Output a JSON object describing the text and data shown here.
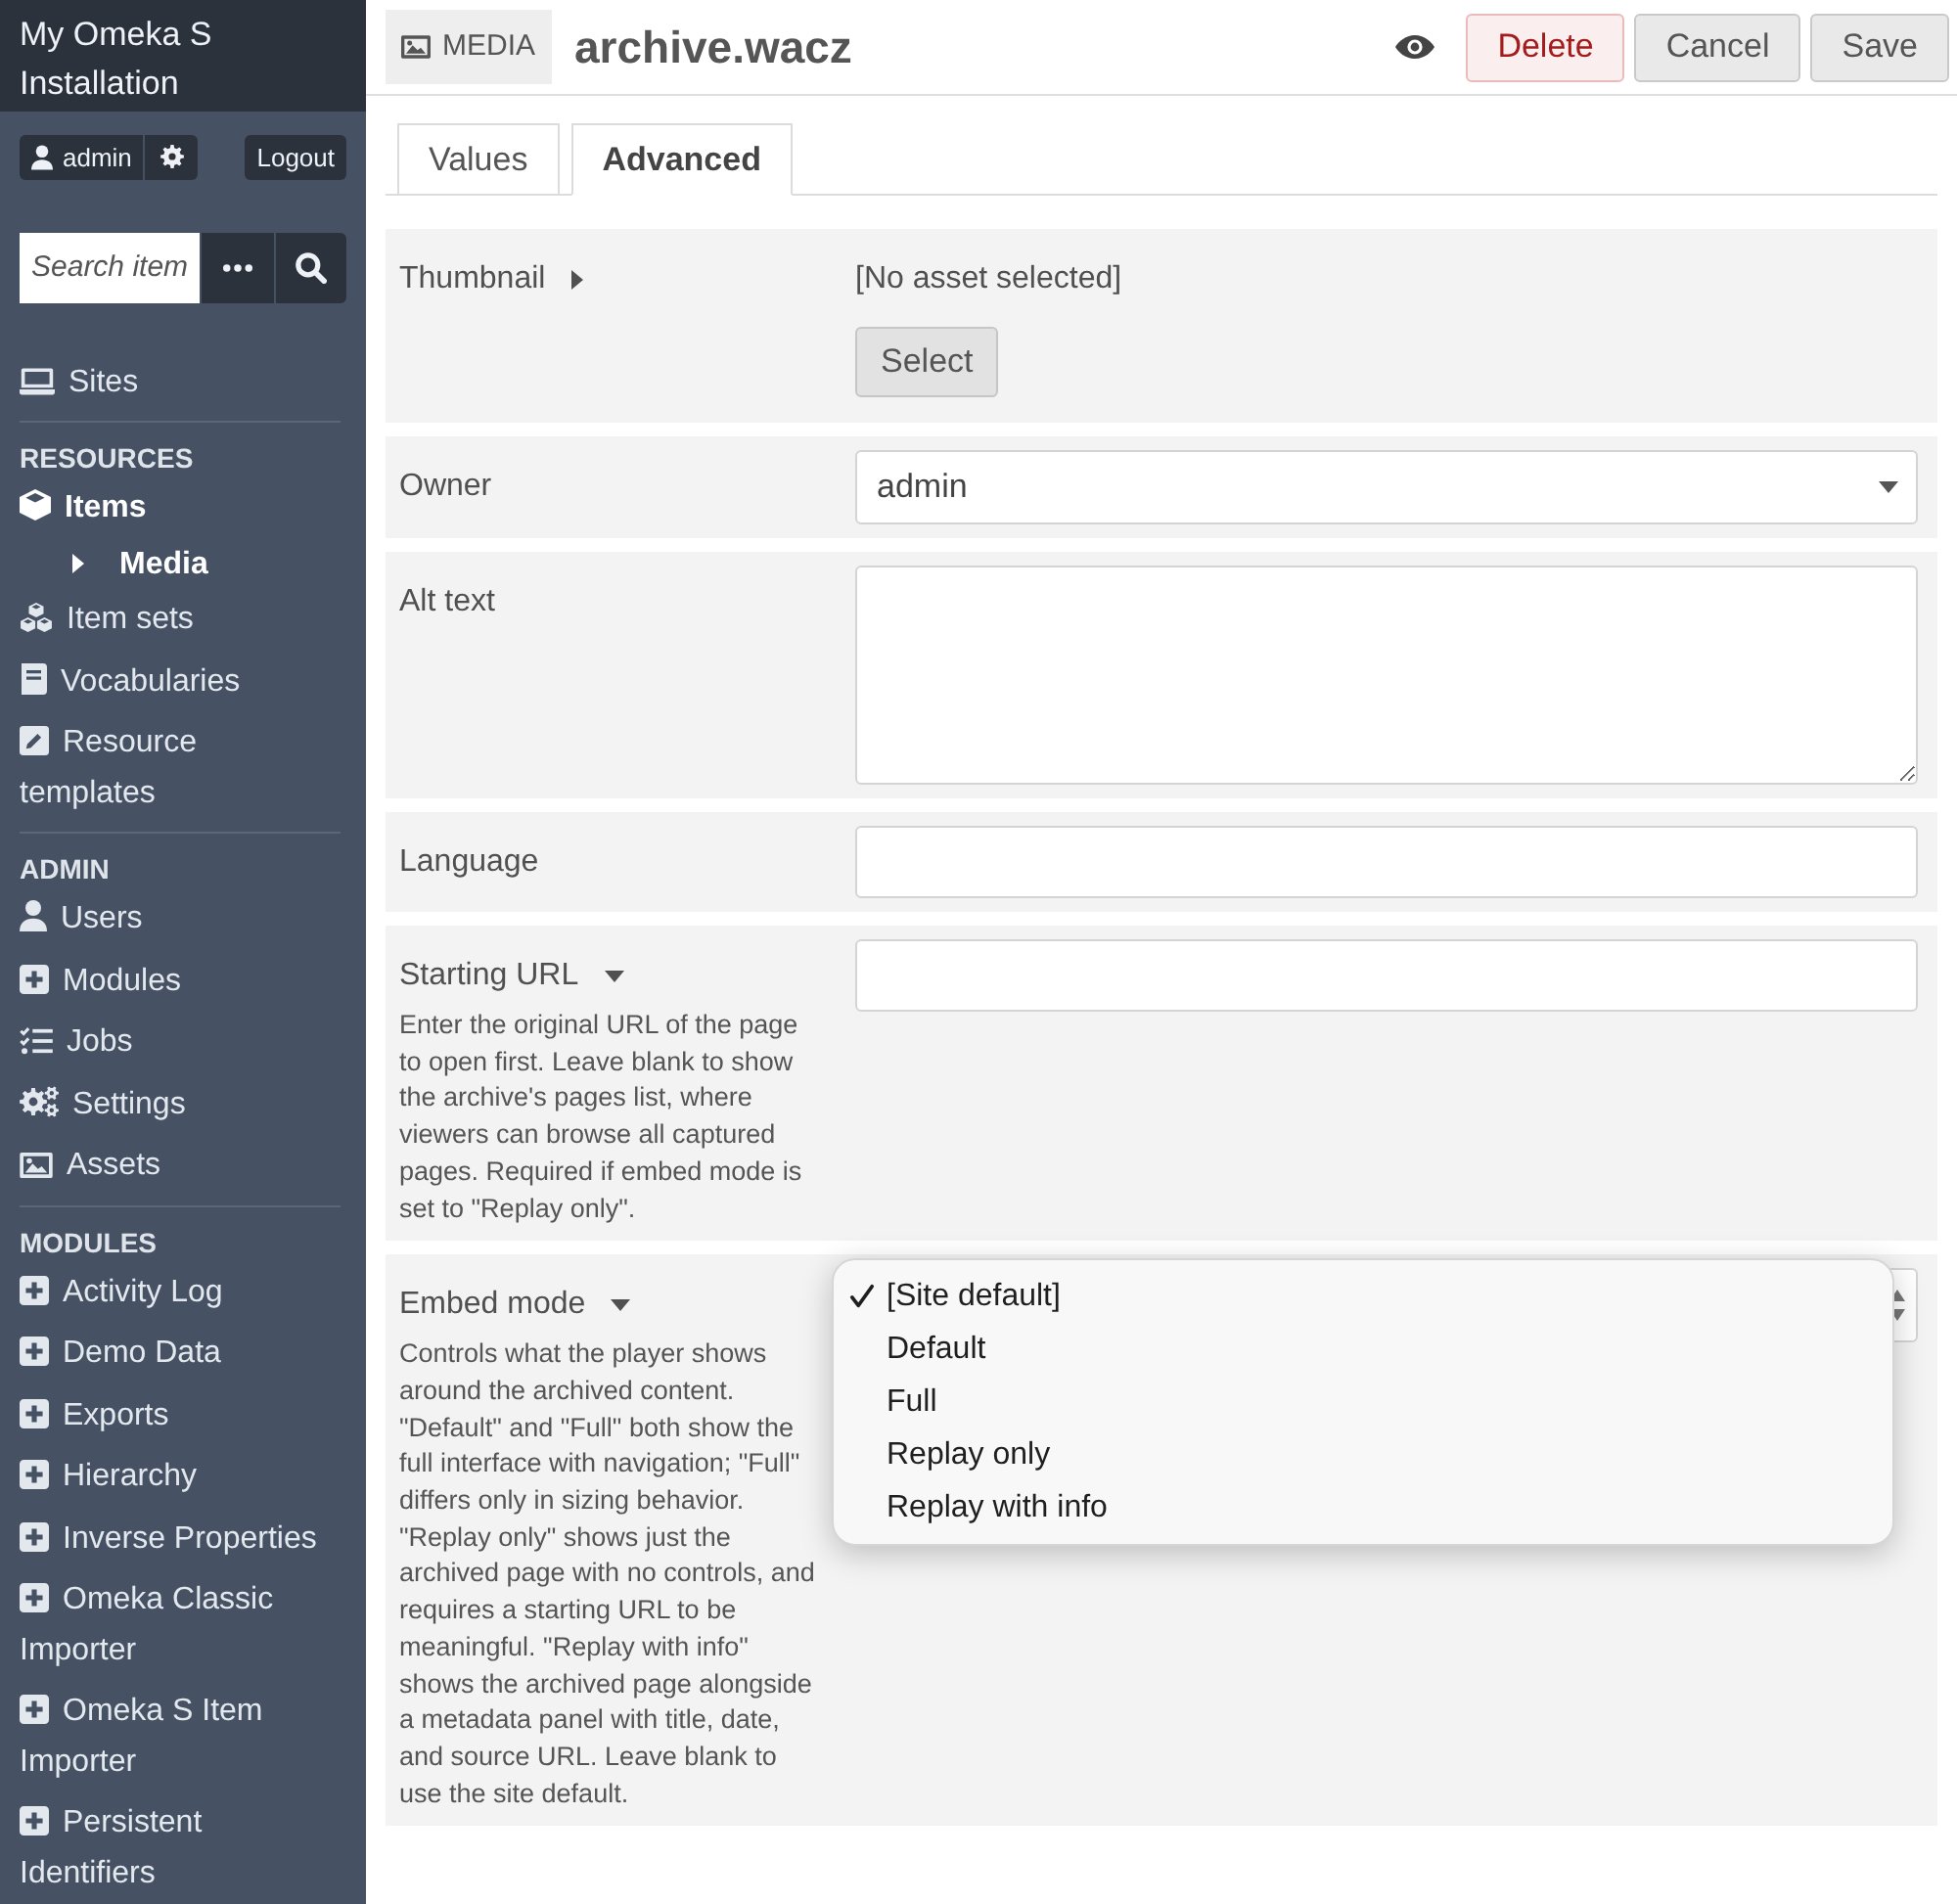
{
  "sidebar": {
    "title": "My Omeka S Installation",
    "user": "admin",
    "logout": "Logout",
    "search": {
      "placeholder": "Search item"
    },
    "sections": [
      {
        "items": [
          {
            "label": "Sites",
            "selected": false
          }
        ]
      },
      {
        "heading": "RESOURCES",
        "items": [
          {
            "label": "Items",
            "selected": true,
            "children": [
              {
                "label": "Media",
                "selected": true
              }
            ]
          },
          {
            "label": "Item sets",
            "selected": false
          },
          {
            "label": "Vocabularies",
            "selected": false
          },
          {
            "label": "Resource templates",
            "selected": false
          }
        ]
      },
      {
        "heading": "ADMIN",
        "items": [
          {
            "label": "Users",
            "selected": false
          },
          {
            "label": "Modules",
            "selected": false
          },
          {
            "label": "Jobs",
            "selected": false
          },
          {
            "label": "Settings",
            "selected": false
          },
          {
            "label": "Assets",
            "selected": false
          }
        ]
      },
      {
        "heading": "MODULES",
        "items": [
          {
            "label": "Activity Log",
            "selected": false
          },
          {
            "label": "Demo Data",
            "selected": false
          },
          {
            "label": "Exports",
            "selected": false
          },
          {
            "label": "Hierarchy",
            "selected": false
          },
          {
            "label": "Inverse Properties",
            "selected": false
          },
          {
            "label": "Omeka Classic Importer",
            "selected": false
          },
          {
            "label": "Omeka S Item Importer",
            "selected": false
          },
          {
            "label": "Persistent Identifiers",
            "selected": false
          }
        ]
      }
    ]
  },
  "header": {
    "badge": "MEDIA",
    "title": "archive.wacz",
    "buttons": [
      {
        "label": "Delete",
        "kind": "danger"
      },
      {
        "label": "Cancel",
        "kind": "plain"
      },
      {
        "label": "Save",
        "kind": "plain"
      }
    ]
  },
  "tabs": [
    {
      "label": "Values",
      "selected": false
    },
    {
      "label": "Advanced",
      "selected": true
    }
  ],
  "fields": [
    {
      "kind": "asset",
      "label": "Thumbnail",
      "expanded": false,
      "value": "[No asset selected]",
      "button": "Select"
    },
    {
      "kind": "select",
      "label": "Owner",
      "value": "admin"
    },
    {
      "kind": "textarea",
      "label": "Alt text"
    },
    {
      "kind": "text",
      "label": "Language"
    },
    {
      "kind": "text",
      "label": "Starting URL",
      "expanded": true,
      "description": "Enter the original URL of the page to open first. Leave blank to show the archive's pages list, where viewers can browse all captured pages. Required if embed mode is set to \"Replay only\"."
    },
    {
      "kind": "select",
      "label": "Embed mode",
      "expanded": true,
      "description": "Controls what the player shows around the archived content. \"Default\" and \"Full\" both show the full interface with navigation; \"Full\" differs only in sizing behavior. \"Replay only\" shows just the archived page with no controls, and requires a starting URL to be meaningful. \"Replay with info\" shows the archived page alongside a metadata panel with title, date, and source URL. Leave blank to use the site default.",
      "open": true,
      "options": [
        {
          "label": "[Site default]",
          "selected": true
        },
        {
          "label": "Default",
          "selected": false
        },
        {
          "label": "Full",
          "selected": false
        },
        {
          "label": "Replay only",
          "selected": false
        },
        {
          "label": "Replay with info",
          "selected": false
        }
      ]
    }
  ]
}
